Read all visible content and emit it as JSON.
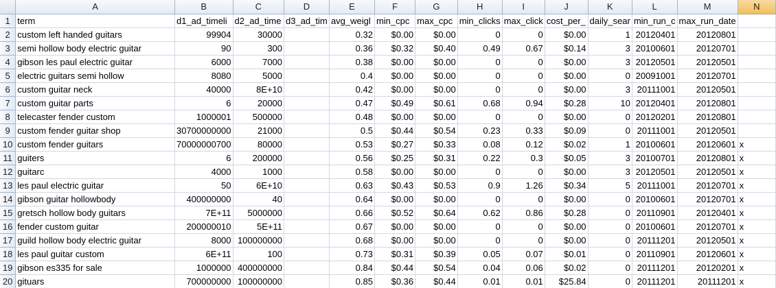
{
  "columns": [
    {
      "letter": "",
      "width": 24
    },
    {
      "letter": "A",
      "width": 246,
      "align": "txt"
    },
    {
      "letter": "B",
      "width": 79,
      "align": "num"
    },
    {
      "letter": "C",
      "width": 75,
      "align": "num"
    },
    {
      "letter": "D",
      "width": 66,
      "align": "txt"
    },
    {
      "letter": "E",
      "width": 67,
      "align": "num"
    },
    {
      "letter": "F",
      "width": 61,
      "align": "num"
    },
    {
      "letter": "G",
      "width": 63,
      "align": "num"
    },
    {
      "letter": "H",
      "width": 64,
      "align": "num"
    },
    {
      "letter": "I",
      "width": 62,
      "align": "num"
    },
    {
      "letter": "J",
      "width": 63,
      "align": "num"
    },
    {
      "letter": "K",
      "width": 63,
      "align": "num"
    },
    {
      "letter": "L",
      "width": 65,
      "align": "num"
    },
    {
      "letter": "M",
      "width": 64,
      "align": "num"
    },
    {
      "letter": "N",
      "width": 68,
      "align": "txt"
    }
  ],
  "selected_column": "N",
  "rows": [
    {
      "n": "1",
      "cells": [
        "term",
        "d1_ad_timeli",
        "d2_ad_time",
        "d3_ad_tim",
        "avg_weigl",
        "min_cpc",
        "max_cpc",
        "min_clicks",
        "max_click",
        "cost_per_",
        "daily_sear",
        "min_run_c",
        "max_run_date",
        ""
      ],
      "header": true
    },
    {
      "n": "2",
      "cells": [
        "custom left handed guitars",
        "99904",
        "30000",
        "",
        "0.32",
        "$0.00",
        "$0.00",
        "0",
        "0",
        "$0.00",
        "1",
        "20120401",
        "20120801",
        ""
      ]
    },
    {
      "n": "3",
      "cells": [
        "semi hollow body electric guitar",
        "90",
        "300",
        "",
        "0.36",
        "$0.32",
        "$0.40",
        "0.49",
        "0.67",
        "$0.14",
        "3",
        "20100601",
        "20120701",
        ""
      ]
    },
    {
      "n": "4",
      "cells": [
        "gibson les paul electric guitar",
        "6000",
        "7000",
        "",
        "0.38",
        "$0.00",
        "$0.00",
        "0",
        "0",
        "$0.00",
        "3",
        "20120501",
        "20120501",
        ""
      ]
    },
    {
      "n": "5",
      "cells": [
        "electric guitars semi hollow",
        "8080",
        "5000",
        "",
        "0.4",
        "$0.00",
        "$0.00",
        "0",
        "0",
        "$0.00",
        "0",
        "20091001",
        "20120701",
        ""
      ]
    },
    {
      "n": "6",
      "cells": [
        "custom guitar neck",
        "40000",
        "8E+10",
        "",
        "0.42",
        "$0.00",
        "$0.00",
        "0",
        "0",
        "$0.00",
        "3",
        "20111001",
        "20120501",
        ""
      ]
    },
    {
      "n": "7",
      "cells": [
        "custom guitar parts",
        "6",
        "20000",
        "",
        "0.47",
        "$0.49",
        "$0.61",
        "0.68",
        "0.94",
        "$0.28",
        "10",
        "20120401",
        "20120801",
        ""
      ]
    },
    {
      "n": "8",
      "cells": [
        "telecaster fender custom",
        "1000001",
        "500000",
        "",
        "0.48",
        "$0.00",
        "$0.00",
        "0",
        "0",
        "$0.00",
        "0",
        "20120201",
        "20120801",
        ""
      ]
    },
    {
      "n": "9",
      "cells": [
        "custom fender guitar shop",
        "30700000000",
        "21000",
        "",
        "0.5",
        "$0.44",
        "$0.54",
        "0.23",
        "0.33",
        "$0.09",
        "0",
        "20111001",
        "20120501",
        ""
      ]
    },
    {
      "n": "10",
      "cells": [
        "custom fender guitars",
        "70000000700",
        "80000",
        "",
        "0.53",
        "$0.27",
        "$0.33",
        "0.08",
        "0.12",
        "$0.02",
        "1",
        "20100601",
        "20120601",
        "x"
      ]
    },
    {
      "n": "11",
      "cells": [
        "guiters",
        "6",
        "200000",
        "",
        "0.56",
        "$0.25",
        "$0.31",
        "0.22",
        "0.3",
        "$0.05",
        "3",
        "20100701",
        "20120801",
        "x"
      ]
    },
    {
      "n": "12",
      "cells": [
        "guitarc",
        "4000",
        "1000",
        "",
        "0.58",
        "$0.00",
        "$0.00",
        "0",
        "0",
        "$0.00",
        "3",
        "20120501",
        "20120501",
        "x"
      ]
    },
    {
      "n": "13",
      "cells": [
        "les paul electric guitar",
        "50",
        "6E+10",
        "",
        "0.63",
        "$0.43",
        "$0.53",
        "0.9",
        "1.26",
        "$0.34",
        "5",
        "20111001",
        "20120701",
        "x"
      ]
    },
    {
      "n": "14",
      "cells": [
        "gibson guitar hollowbody",
        "400000000",
        "40",
        "",
        "0.64",
        "$0.00",
        "$0.00",
        "0",
        "0",
        "$0.00",
        "0",
        "20100601",
        "20120701",
        "x"
      ]
    },
    {
      "n": "15",
      "cells": [
        "gretsch hollow body guitars",
        "7E+11",
        "5000000",
        "",
        "0.66",
        "$0.52",
        "$0.64",
        "0.62",
        "0.86",
        "$0.28",
        "0",
        "20110901",
        "20120401",
        "x"
      ]
    },
    {
      "n": "16",
      "cells": [
        "fender custom guitar",
        "200000010",
        "5E+11",
        "",
        "0.67",
        "$0.00",
        "$0.00",
        "0",
        "0",
        "$0.00",
        "0",
        "20100601",
        "20120701",
        "x"
      ]
    },
    {
      "n": "17",
      "cells": [
        "guild hollow body electric guitar",
        "8000",
        "100000000",
        "",
        "0.68",
        "$0.00",
        "$0.00",
        "0",
        "0",
        "$0.00",
        "0",
        "20111201",
        "20120501",
        "x"
      ]
    },
    {
      "n": "18",
      "cells": [
        "les paul guitar custom",
        "6E+11",
        "100",
        "",
        "0.73",
        "$0.31",
        "$0.39",
        "0.05",
        "0.07",
        "$0.01",
        "0",
        "20110901",
        "20120601",
        "x"
      ]
    },
    {
      "n": "19",
      "cells": [
        "gibson es335 for sale",
        "1000000",
        "400000000",
        "",
        "0.84",
        "$0.44",
        "$0.54",
        "0.04",
        "0.06",
        "$0.02",
        "0",
        "20111201",
        "20120201",
        "x"
      ]
    },
    {
      "n": "20",
      "cells": [
        "gituars",
        "700000000",
        "100000000",
        "",
        "0.85",
        "$0.36",
        "$0.44",
        "0.01",
        "0.01",
        "$25.84",
        "0",
        "20111201",
        "20111201",
        "x"
      ]
    }
  ]
}
